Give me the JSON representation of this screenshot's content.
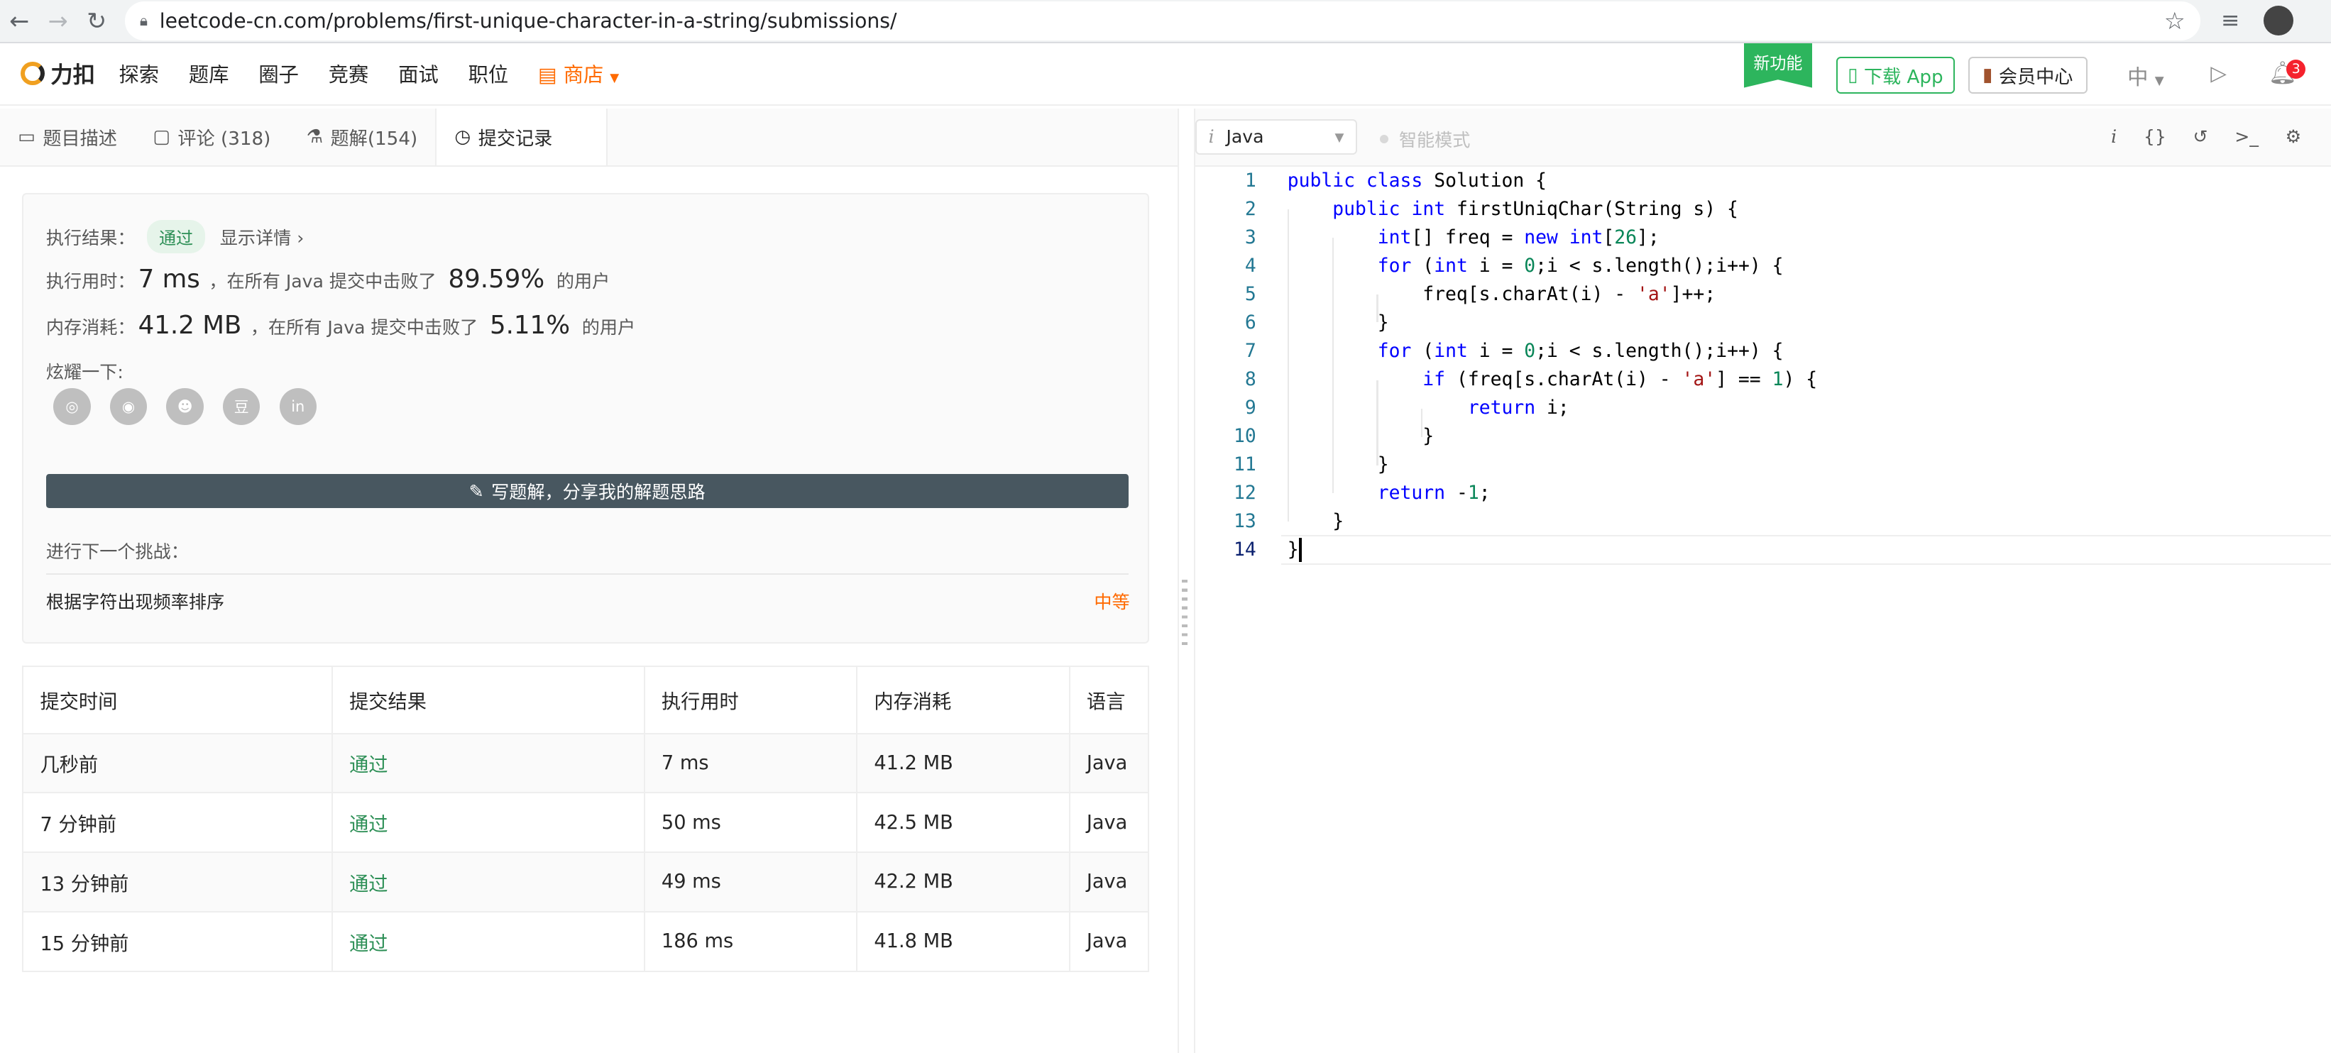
{
  "browser": {
    "url": "leetcode-cn.com/problems/first-unique-character-in-a-string/submissions/"
  },
  "site": {
    "logo": "力扣",
    "nav": [
      "探索",
      "题库",
      "圈子",
      "竞赛",
      "面试",
      "职位"
    ],
    "shop": "商店",
    "new_feature": "新功能",
    "download_app": "下载 App",
    "vip_center": "会员中心",
    "lang": "中",
    "notification_count": "3"
  },
  "tabs": [
    {
      "label": "题目描述"
    },
    {
      "label": "评论 (318)"
    },
    {
      "label": "题解(154)"
    },
    {
      "label": "提交记录"
    }
  ],
  "result": {
    "status_label": "执行结果：",
    "status": "通过",
    "detail_link": "显示详情 ›",
    "runtime_label": "执行用时：",
    "runtime": "7 ms",
    "runtime_beat_text": "，在所有 Java 提交中击败了",
    "runtime_beat": "89.59%",
    "users_suffix": "的用户",
    "memory_label": "内存消耗：",
    "memory": "41.2 MB",
    "memory_beat_text": "，在所有 Java 提交中击败了",
    "memory_beat": "5.11%",
    "share_label": "炫耀一下:",
    "share_icons": [
      "wechat-icon",
      "weibo-icon",
      "qq-icon",
      "douban-icon",
      "linkedin-icon"
    ],
    "write_solution": "写题解，分享我的解题思路",
    "next_challenge_label": "进行下一个挑战：",
    "next_challenge_title": "根据字符出现频率排序",
    "next_challenge_difficulty": "中等"
  },
  "submissions": {
    "headers": [
      "提交时间",
      "提交结果",
      "执行用时",
      "内存消耗",
      "语言"
    ],
    "rows": [
      [
        "几秒前",
        "通过",
        "7 ms",
        "41.2 MB",
        "Java"
      ],
      [
        "7 分钟前",
        "通过",
        "50 ms",
        "42.5 MB",
        "Java"
      ],
      [
        "13 分钟前",
        "通过",
        "49 ms",
        "42.2 MB",
        "Java"
      ],
      [
        "15 分钟前",
        "通过",
        "186 ms",
        "41.8 MB",
        "Java"
      ]
    ]
  },
  "editor": {
    "language": "Java",
    "smart_mode": "智能模式",
    "line_numbers": [
      "1",
      "2",
      "3",
      "4",
      "5",
      "6",
      "7",
      "8",
      "9",
      "10",
      "11",
      "12",
      "13",
      "14"
    ],
    "code_lines": [
      "public class Solution {",
      "    public int firstUniqChar(String s) {",
      "        int[] freq = new int[26];",
      "        for (int i = 0;i < s.length();i++) {",
      "            freq[s.charAt(i) - 'a']++;",
      "        }",
      "        for (int i = 0;i < s.length();i++) {",
      "            if (freq[s.charAt(i) - 'a'] == 1) {",
      "                return i;",
      "            }",
      "        }",
      "        return -1;",
      "    }",
      "}"
    ]
  },
  "colors": {
    "success": "#2d8f56",
    "brand_orange": "#ff6a00",
    "keyword": "#0000ff",
    "number": "#098658",
    "string": "#a31515"
  }
}
